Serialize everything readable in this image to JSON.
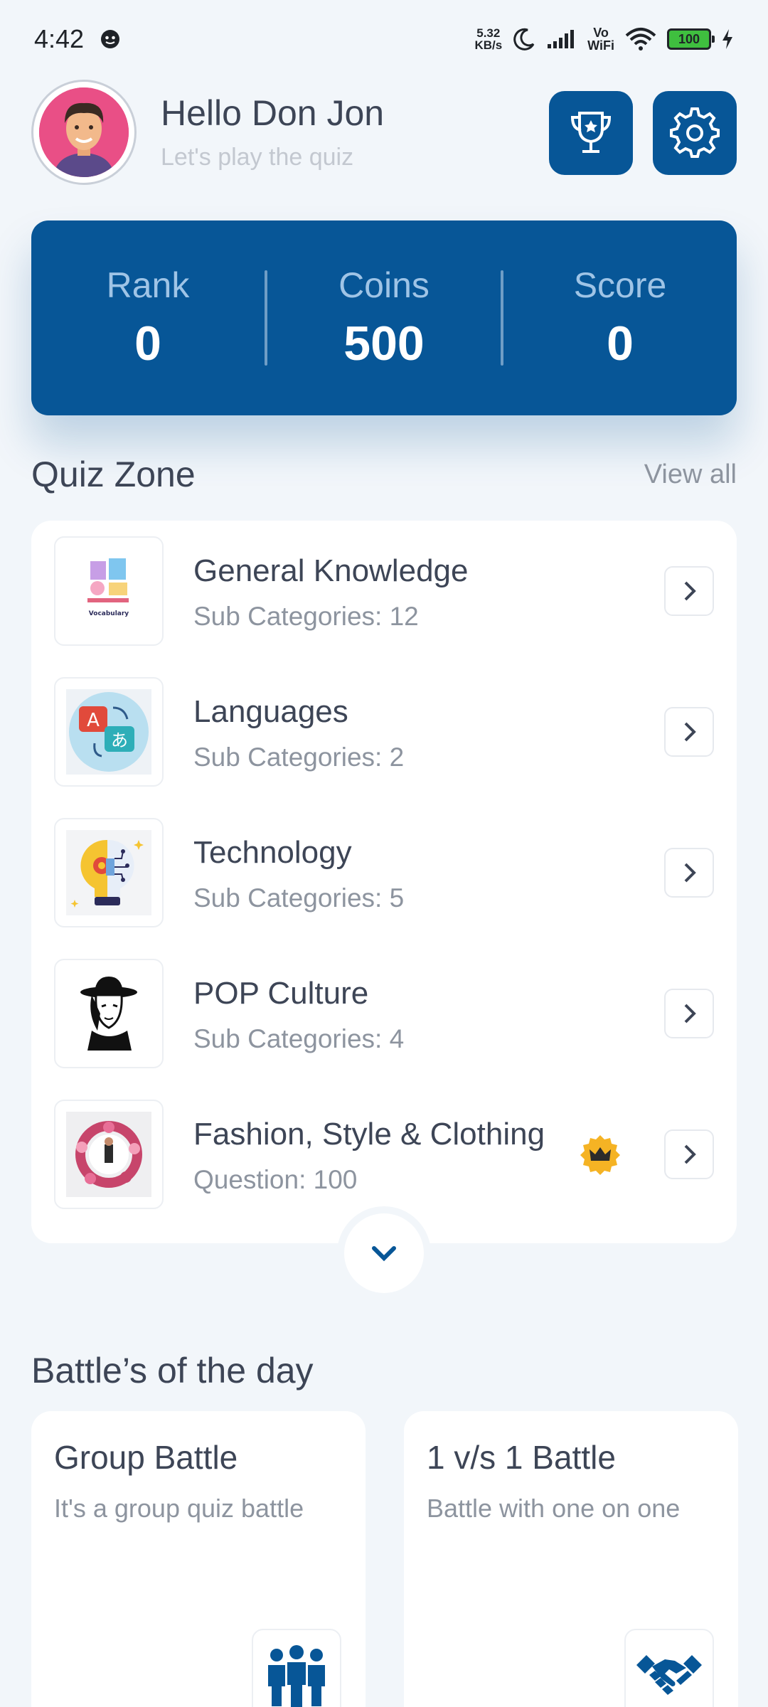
{
  "status_bar": {
    "time": "4:42",
    "speed_value": "5.32",
    "speed_unit": "KB/s",
    "vo": "Vo",
    "wifi": "WiFi",
    "battery": "100"
  },
  "header": {
    "greeting": "Hello Don Jon",
    "subtitle": "Let's play the quiz",
    "trophy_icon": "trophy-icon",
    "settings_icon": "gear-icon"
  },
  "stats": {
    "rank_label": "Rank",
    "rank_value": "0",
    "coins_label": "Coins",
    "coins_value": "500",
    "score_label": "Score",
    "score_value": "0"
  },
  "quiz_zone": {
    "title": "Quiz Zone",
    "view_all": "View all",
    "items": [
      {
        "title": "General Knowledge",
        "subtitle": "Sub Categories: 12",
        "icon": "vocabulary-icon",
        "thumb_text": "Vocabulary"
      },
      {
        "title": "Languages",
        "subtitle": "Sub Categories: 2",
        "icon": "translate-icon",
        "thumb_text_a": "A",
        "thumb_text_b": "あ"
      },
      {
        "title": "Technology",
        "subtitle": "Sub Categories: 5",
        "icon": "lightbulb-gear-icon"
      },
      {
        "title": "POP Culture",
        "subtitle": "Sub Categories: 4",
        "icon": "hat-portrait-icon"
      },
      {
        "title": "Fashion, Style & Clothing",
        "subtitle": "Question: 100",
        "icon": "floral-wreath-icon",
        "premium": true
      }
    ]
  },
  "battles": {
    "title": "Battle’s of the day",
    "group": {
      "title": "Group Battle",
      "description": "It's a group quiz battle",
      "icon": "group-people-icon"
    },
    "one_vs_one": {
      "title": "1 v/s 1 Battle",
      "description": "Battle with one on one",
      "icon": "handshake-icon"
    }
  },
  "colors": {
    "primary": "#075697",
    "background": "#f2f6fa",
    "text": "#3d4556",
    "muted": "#8d949f",
    "crown": "#f5b324"
  }
}
